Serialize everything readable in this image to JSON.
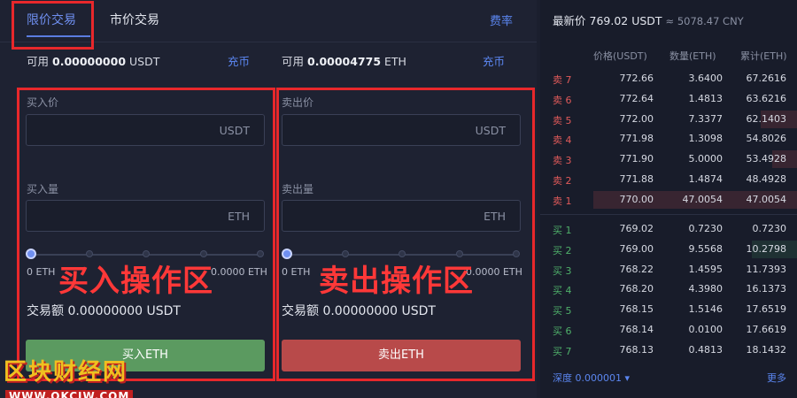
{
  "tabs": {
    "limit": "限价交易",
    "market": "市价交易",
    "fee": "费率"
  },
  "buy": {
    "available_label": "可用",
    "available_value": "0.00000000",
    "available_unit": "USDT",
    "recharge": "充币",
    "price_label": "买入价",
    "price_unit": "USDT",
    "qty_label": "买入量",
    "qty_unit": "ETH",
    "slider_min": "0 ETH",
    "slider_max": "0.0000 ETH",
    "slider_percent": 0,
    "amount_label": "交易额",
    "amount_value": "0.00000000 USDT",
    "button": "买入ETH",
    "overlay": "买入操作区"
  },
  "sell": {
    "available_label": "可用",
    "available_value": "0.00004775",
    "available_unit": "ETH",
    "recharge": "充币",
    "price_label": "卖出价",
    "price_unit": "USDT",
    "qty_label": "卖出量",
    "qty_unit": "ETH",
    "slider_min": "0 ETH",
    "slider_max": "0.0000 ETH",
    "slider_percent": 0,
    "amount_label": "交易额",
    "amount_value": "0.00000000 USDT",
    "button": "卖出ETH",
    "overlay": "卖出操作区"
  },
  "orderbook": {
    "latest_label": "最新价",
    "latest_price": "769.02 USDT",
    "latest_cny": "≈ 5078.47 CNY",
    "col_price": "价格(USDT)",
    "col_qty": "数量(ETH)",
    "col_cum": "累计(ETH)",
    "asks": [
      {
        "side": "卖 7",
        "price": "772.66",
        "qty": "3.6400",
        "cum": "67.2616",
        "depth_fraction": 0.0
      },
      {
        "side": "卖 6",
        "price": "772.64",
        "qty": "1.4813",
        "cum": "63.6216",
        "depth_fraction": 0.0
      },
      {
        "side": "卖 5",
        "price": "772.00",
        "qty": "7.3377",
        "cum": "62.1403",
        "depth_fraction": 0.18
      },
      {
        "side": "卖 4",
        "price": "771.98",
        "qty": "1.3098",
        "cum": "54.8026",
        "depth_fraction": 0.0
      },
      {
        "side": "卖 3",
        "price": "771.90",
        "qty": "5.0000",
        "cum": "53.4928",
        "depth_fraction": 0.12
      },
      {
        "side": "卖 2",
        "price": "771.88",
        "qty": "1.4874",
        "cum": "48.4928",
        "depth_fraction": 0.0
      },
      {
        "side": "卖 1",
        "price": "770.00",
        "qty": "47.0054",
        "cum": "47.0054",
        "depth_fraction": 1.0
      }
    ],
    "bids": [
      {
        "side": "买 1",
        "price": "769.02",
        "qty": "0.7230",
        "cum": "0.7230",
        "depth_fraction": 0.0
      },
      {
        "side": "买 2",
        "price": "769.00",
        "qty": "9.5568",
        "cum": "10.2798",
        "depth_fraction": 0.22
      },
      {
        "side": "买 3",
        "price": "768.22",
        "qty": "1.4595",
        "cum": "11.7393",
        "depth_fraction": 0.0
      },
      {
        "side": "买 4",
        "price": "768.20",
        "qty": "4.3980",
        "cum": "16.1373",
        "depth_fraction": 0.0
      },
      {
        "side": "买 5",
        "price": "768.15",
        "qty": "1.5146",
        "cum": "17.6519",
        "depth_fraction": 0.0
      },
      {
        "side": "买 6",
        "price": "768.14",
        "qty": "0.0100",
        "cum": "17.6619",
        "depth_fraction": 0.0
      },
      {
        "side": "买 7",
        "price": "768.13",
        "qty": "0.4813",
        "cum": "18.1432",
        "depth_fraction": 0.0
      }
    ],
    "depth_label": "深度 0.000001",
    "more": "更多"
  },
  "watermark": {
    "cn": "区块财经网",
    "url": "WWW.QKCJW.COM"
  },
  "colors": {
    "accent": "#5b86f0",
    "buy": "#5b9a60",
    "sell": "#b84a4a",
    "annotation": "#e8282b"
  }
}
